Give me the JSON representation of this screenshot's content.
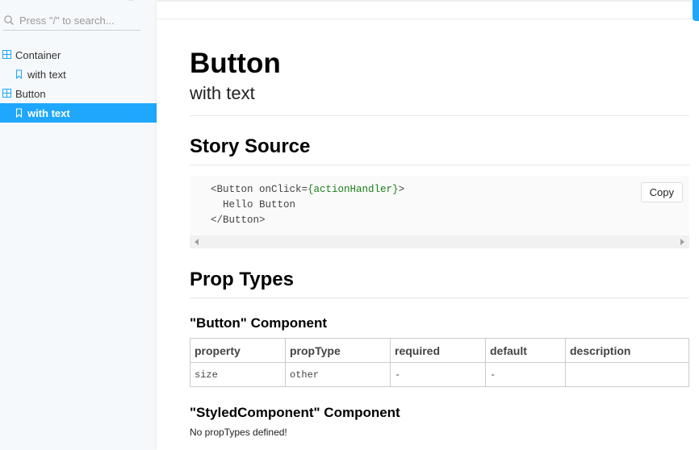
{
  "sidebar": {
    "search_placeholder": "Press \"/\" to search...",
    "items": [
      {
        "label": "Container",
        "kind": "component",
        "icon": "component-icon"
      },
      {
        "label": "with text",
        "kind": "story",
        "icon": "bookmark-icon"
      },
      {
        "label": "Button",
        "kind": "component",
        "icon": "component-icon"
      },
      {
        "label": "with text",
        "kind": "story",
        "icon": "bookmark-icon",
        "selected": true
      }
    ]
  },
  "main": {
    "title": "Button",
    "subtitle": "with text",
    "story_source_heading": "Story Source",
    "code": {
      "line1_pre": "<Button onClick=",
      "line1_attr": "{actionHandler}",
      "line1_post": ">",
      "line2": "  Hello Button",
      "line3": "</Button>"
    },
    "copy_label": "Copy",
    "prop_types_heading": "Prop Types",
    "components": [
      {
        "heading": "\"Button\" Component",
        "columns": [
          "property",
          "propType",
          "required",
          "default",
          "description"
        ],
        "rows": [
          [
            "size",
            "other",
            "-",
            "-",
            ""
          ]
        ]
      },
      {
        "heading": "\"StyledComponent\" Component",
        "note": "No propTypes defined!"
      }
    ]
  },
  "colors": {
    "accent": "#1ea7fd",
    "sidebar_bg": "#f6f9fc",
    "code_attr": "#1a7f1a"
  }
}
